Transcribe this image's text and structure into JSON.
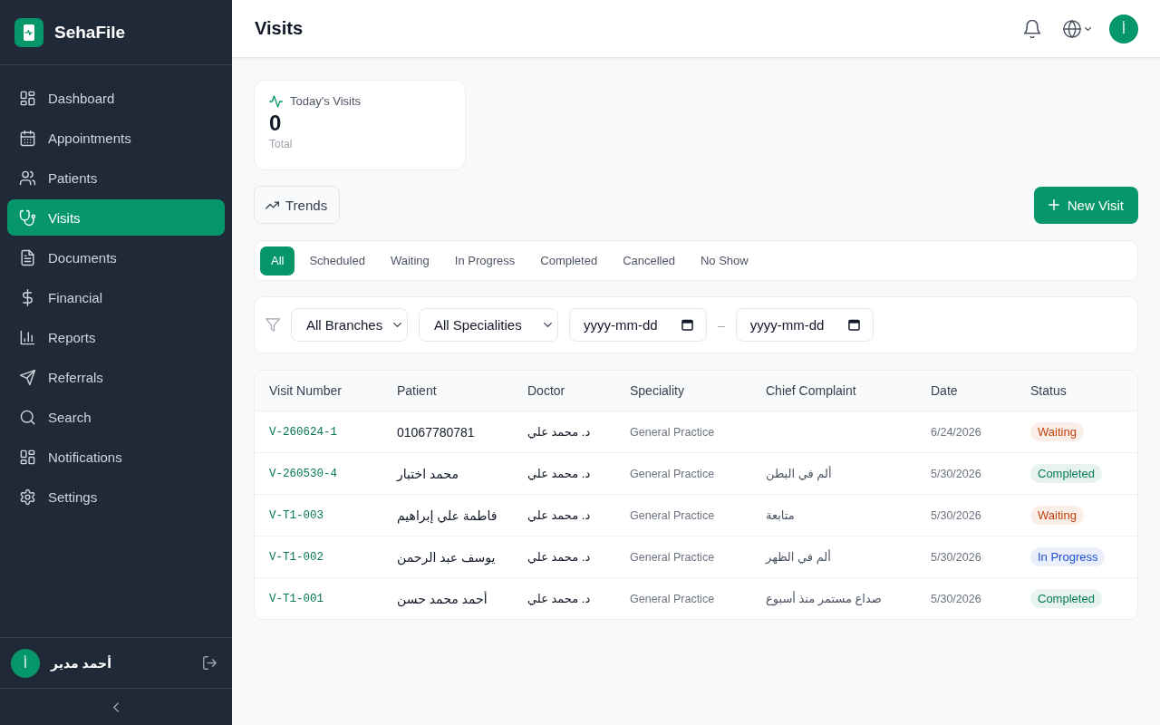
{
  "sidebar": {
    "brand": "SehaFile",
    "items": [
      {
        "label": "Dashboard",
        "selected": false
      },
      {
        "label": "Appointments",
        "selected": false
      },
      {
        "label": "Patients",
        "selected": false
      },
      {
        "label": "Visits",
        "selected": true
      },
      {
        "label": "Documents",
        "selected": false
      },
      {
        "label": "Financial",
        "selected": false
      },
      {
        "label": "Reports",
        "selected": false
      },
      {
        "label": "Referrals",
        "selected": false
      },
      {
        "label": "Search",
        "selected": false
      },
      {
        "label": "Notifications",
        "selected": false
      },
      {
        "label": "Settings",
        "selected": false
      }
    ],
    "user": {
      "initial": "أ",
      "name": "أحمد مدير"
    }
  },
  "header": {
    "title": "Visits",
    "avatar_initial": "أ"
  },
  "stat_card": {
    "label": "Today's Visits",
    "value": "0",
    "caption": "Total"
  },
  "actions": {
    "trends": "Trends",
    "new_visit": "New Visit"
  },
  "status_tabs": [
    {
      "label": "All",
      "selected": true
    },
    {
      "label": "Scheduled",
      "selected": false
    },
    {
      "label": "Waiting",
      "selected": false
    },
    {
      "label": "In Progress",
      "selected": false
    },
    {
      "label": "Completed",
      "selected": false
    },
    {
      "label": "Cancelled",
      "selected": false
    },
    {
      "label": "No Show",
      "selected": false
    }
  ],
  "filters": {
    "branch": "All Branches",
    "speciality": "All Specialities",
    "date_from": {
      "placeholder": "yyyy-mm-dd"
    },
    "date_separator": "–",
    "date_to": {
      "placeholder": "yyyy-mm-dd"
    }
  },
  "table": {
    "columns": [
      "Visit Number",
      "Patient",
      "Doctor",
      "Speciality",
      "Chief Complaint",
      "Date",
      "Status"
    ],
    "rows": [
      {
        "visit_number": "V-260624-1",
        "patient": "01067780781",
        "doctor": "د. محمد علي",
        "speciality": "General Practice",
        "date": "6/24/2026",
        "status": {
          "label": "Waiting",
          "color": "#c2410c"
        }
      },
      {
        "visit_number": "V-260530-4",
        "patient": "محمد اختبار",
        "doctor": "د. محمد علي",
        "speciality": "General Practice",
        "chief_complaint": "ألم في البطن",
        "date": "5/30/2026",
        "status": {
          "label": "Completed",
          "color": "#047857"
        }
      },
      {
        "visit_number": "V-T1-003",
        "patient": "فاطمة علي إبراهيم",
        "doctor": "د. محمد علي",
        "speciality": "General Practice",
        "chief_complaint": "متابعة",
        "date": "5/30/2026",
        "status": {
          "label": "Waiting",
          "color": "#c2410c"
        }
      },
      {
        "visit_number": "V-T1-002",
        "patient": "يوسف عبد الرحمن",
        "doctor": "د. محمد علي",
        "speciality": "General Practice",
        "chief_complaint": "ألم في الظهر",
        "date": "5/30/2026",
        "status": {
          "label": "In Progress",
          "color": "#1d4ed8"
        }
      },
      {
        "visit_number": "V-T1-001",
        "patient": "أحمد محمد حسن",
        "doctor": "د. محمد علي",
        "speciality": "General Practice",
        "chief_complaint": "صداع مستمر منذ أسبوع",
        "date": "5/30/2026",
        "status": {
          "label": "Completed",
          "color": "#047857"
        }
      }
    ]
  }
}
